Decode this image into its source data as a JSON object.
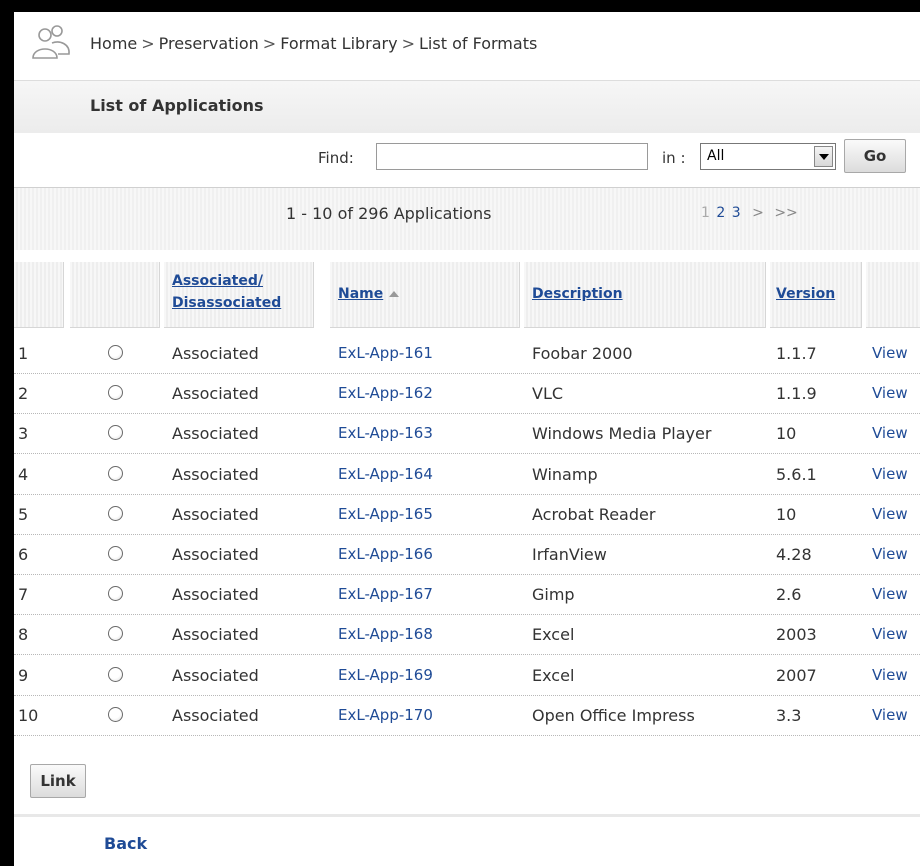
{
  "breadcrumb": {
    "items": [
      "Home",
      "Preservation",
      "Format Library",
      "List of Formats"
    ],
    "separator": ">"
  },
  "icons": {
    "user": "users-icon"
  },
  "page": {
    "title": "List of Applications"
  },
  "find": {
    "label": "Find:",
    "value": "",
    "in_label": "in :",
    "scope": "All",
    "go_label": "Go"
  },
  "pager": {
    "summary": "1 - 10 of 296 Applications",
    "pages": [
      "1",
      "2",
      "3"
    ],
    "next": ">",
    "last": ">>"
  },
  "table": {
    "headers": {
      "associated_1": "Associated/",
      "associated_2": "Disassociated",
      "name": "Name",
      "description": "Description",
      "version": "Version"
    },
    "rows": [
      {
        "num": "1",
        "status": "Associated",
        "name": "ExL-App-161",
        "description": "Foobar 2000",
        "version": "1.1.7",
        "action": "View"
      },
      {
        "num": "2",
        "status": "Associated",
        "name": "ExL-App-162",
        "description": "VLC",
        "version": "1.1.9",
        "action": "View"
      },
      {
        "num": "3",
        "status": "Associated",
        "name": "ExL-App-163",
        "description": "Windows Media Player",
        "version": "10",
        "action": "View"
      },
      {
        "num": "4",
        "status": "Associated",
        "name": "ExL-App-164",
        "description": "Winamp",
        "version": "5.6.1",
        "action": "View"
      },
      {
        "num": "5",
        "status": "Associated",
        "name": "ExL-App-165",
        "description": "Acrobat Reader",
        "version": "10",
        "action": "View"
      },
      {
        "num": "6",
        "status": "Associated",
        "name": "ExL-App-166",
        "description": "IrfanView",
        "version": "4.28",
        "action": "View"
      },
      {
        "num": "7",
        "status": "Associated",
        "name": "ExL-App-167",
        "description": "Gimp",
        "version": "2.6",
        "action": "View"
      },
      {
        "num": "8",
        "status": "Associated",
        "name": "ExL-App-168",
        "description": "Excel",
        "version": "2003",
        "action": "View"
      },
      {
        "num": "9",
        "status": "Associated",
        "name": "ExL-App-169",
        "description": "Excel",
        "version": "2007",
        "action": "View"
      },
      {
        "num": "10",
        "status": "Associated",
        "name": "ExL-App-170",
        "description": "Open Office Impress",
        "version": "3.3",
        "action": "View"
      }
    ]
  },
  "actions": {
    "link_label": "Link",
    "back_label": "Back"
  },
  "colors": {
    "link": "#1f4b96",
    "text": "#333333",
    "border": "#000000"
  }
}
